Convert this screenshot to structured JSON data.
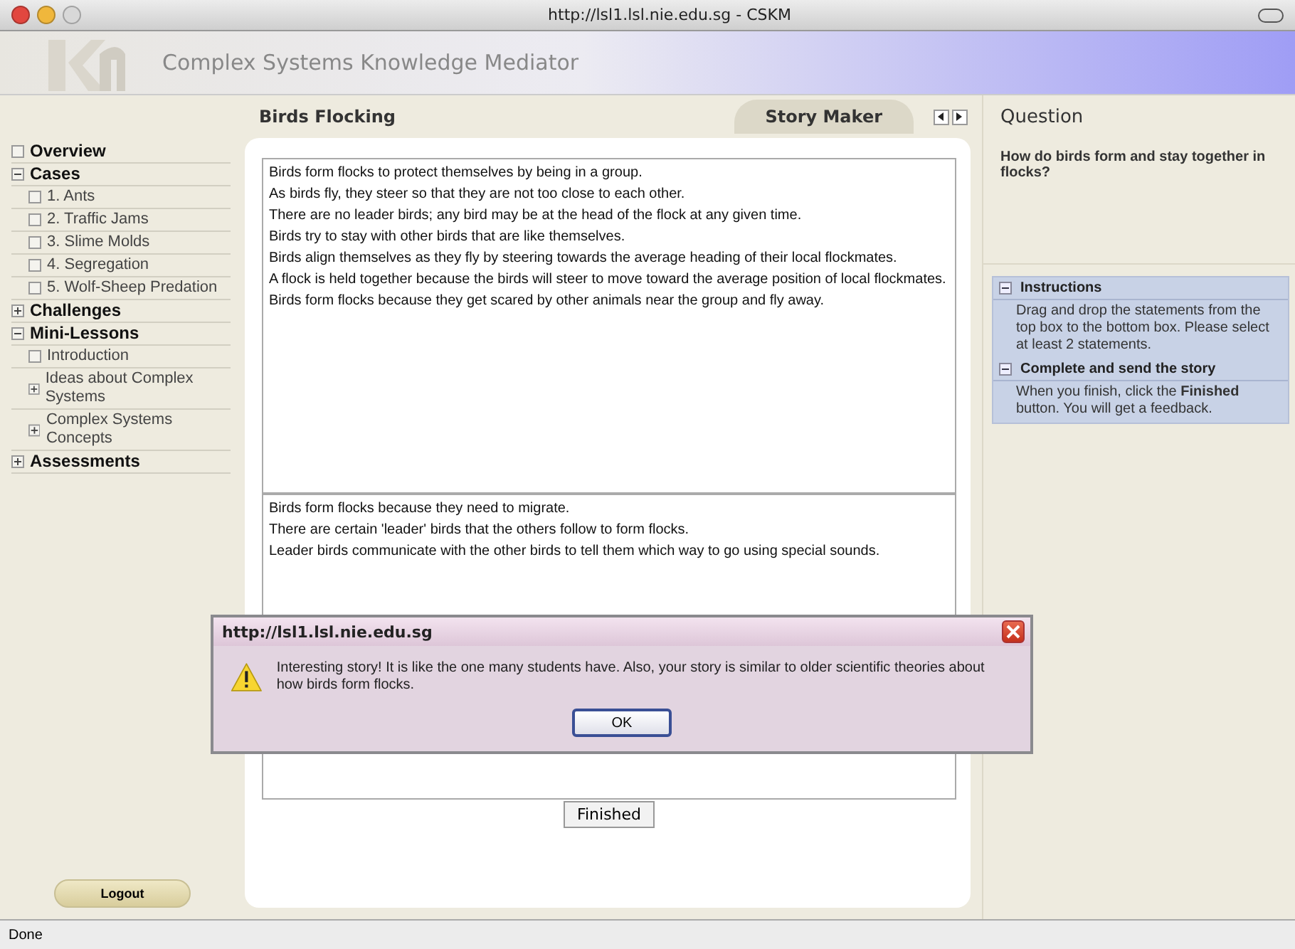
{
  "window": {
    "title": "http://lsl1.lsl.nie.edu.sg - CSKM"
  },
  "header": {
    "title": "Complex Systems Knowledge Mediator"
  },
  "sidebar": {
    "items": [
      {
        "label": "Overview",
        "kind": "leaf"
      },
      {
        "label": "Cases",
        "kind": "branch",
        "expanded": true,
        "children": [
          {
            "label": "1. Ants",
            "kind": "leaf"
          },
          {
            "label": "2. Traffic Jams",
            "kind": "leaf"
          },
          {
            "label": "3. Slime Molds",
            "kind": "leaf"
          },
          {
            "label": "4. Segregation",
            "kind": "leaf"
          },
          {
            "label": "5. Wolf-Sheep Predation",
            "kind": "leaf"
          }
        ]
      },
      {
        "label": "Challenges",
        "kind": "branch",
        "expanded": false
      },
      {
        "label": "Mini-Lessons",
        "kind": "branch",
        "expanded": true,
        "children": [
          {
            "label": "Introduction",
            "kind": "leaf"
          },
          {
            "label": "Ideas about Complex Systems",
            "kind": "branch",
            "expanded": false
          },
          {
            "label": "Complex Systems Concepts",
            "kind": "branch",
            "expanded": false
          }
        ]
      },
      {
        "label": "Assessments",
        "kind": "branch",
        "expanded": false
      }
    ],
    "logout": "Logout"
  },
  "main": {
    "title": "Birds Flocking",
    "tab": "Story Maker",
    "statements": [
      "Birds form flocks to protect themselves by being in a group.",
      "As birds fly, they steer so that they are not too close to each other.",
      "There are no leader birds; any bird may be at the head of the flock at any given time.",
      "Birds try to stay with other birds that are like themselves.",
      "Birds align themselves as they fly by steering towards the average heading of their local flockmates.",
      "A flock is held together because the birds will steer to move toward the average position of local flockmates.",
      "Birds form flocks because they get scared by other animals near the group and fly away."
    ],
    "story": [
      "Birds form flocks because they need to migrate.",
      "There are certain 'leader' birds that the others follow to form flocks.",
      "Leader birds communicate with the other birds to tell them which way to go using special sounds."
    ],
    "finish_button": "Finished"
  },
  "question": {
    "title": "Question",
    "text": "How do birds form and stay together in flocks?",
    "sections": [
      {
        "title": "Instructions",
        "expanded": true,
        "text": "Drag and drop the statements from the top box to the bottom box. Please select at least 2 statements."
      },
      {
        "title": "Complete and send the story",
        "expanded": true,
        "text": "When you finish, click the **Finished** button. You will get a feedback."
      }
    ]
  },
  "dialog": {
    "title": "http://lsl1.lsl.nie.edu.sg",
    "message": "Interesting story! It is like the one many students have. Also, your story is similar to older scientific theories about how birds form flocks.",
    "button": "OK"
  },
  "status_bar": "Done"
}
